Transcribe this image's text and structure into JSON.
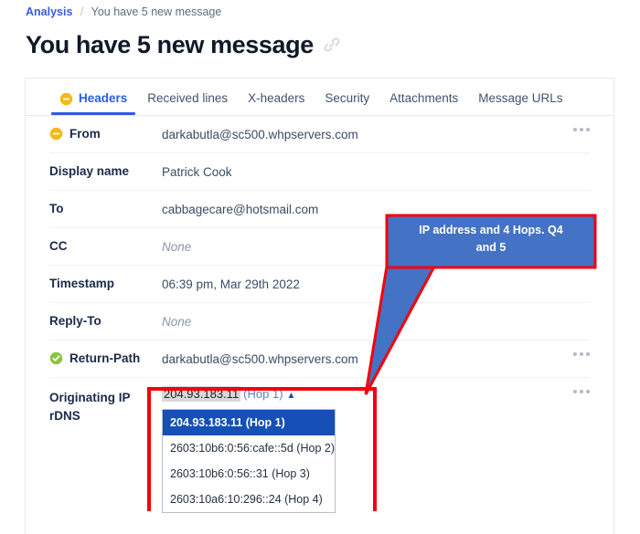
{
  "breadcrumb": {
    "root_label": "Analysis",
    "separator": "/",
    "current_label": "You have 5 new message"
  },
  "header": {
    "title": "You have 5 new message",
    "link_icon": "link-icon"
  },
  "tabs": [
    {
      "label": "Headers",
      "active": true,
      "icon": "minus-circle-warning-icon"
    },
    {
      "label": "Received lines",
      "active": false
    },
    {
      "label": "X-headers",
      "active": false
    },
    {
      "label": "Security",
      "active": false
    },
    {
      "label": "Attachments",
      "active": false
    },
    {
      "label": "Message URLs",
      "active": false
    }
  ],
  "rows": [
    {
      "label": "From",
      "value": "darkabutla@sc500.whpservers.com",
      "icon": "minus-circle-warning-icon",
      "is_none": false,
      "more": true
    },
    {
      "label": "Display name",
      "value": "Patrick Cook",
      "icon": null,
      "is_none": false,
      "more": false
    },
    {
      "label": "To",
      "value": "cabbagecare@hotsmail.com",
      "icon": null,
      "is_none": false,
      "more": false
    },
    {
      "label": "CC",
      "value": "None",
      "icon": null,
      "is_none": true,
      "more": false
    },
    {
      "label": "Timestamp",
      "value": "06:39 pm, Mar 29th 2022",
      "icon": null,
      "is_none": false,
      "more": false
    },
    {
      "label": "Reply-To",
      "value": "None",
      "icon": null,
      "is_none": true,
      "more": false
    },
    {
      "label": "Return-Path",
      "value": "darkabutla@sc500.whpservers.com",
      "icon": "check-circle-success-icon",
      "is_none": false,
      "more": true
    }
  ],
  "originating": {
    "label_line1": "Originating IP",
    "label_line2": "rDNS",
    "selected_ip": "204.93.183.11",
    "selected_hop": "(Hop 1)",
    "caret": "▲",
    "options": [
      {
        "text": "204.93.183.11 (Hop 1)",
        "selected": true
      },
      {
        "text": "2603:10b6:0:56:cafe::5d (Hop 2)",
        "selected": false
      },
      {
        "text": "2603:10b6:0:56::31 (Hop 3)",
        "selected": false
      },
      {
        "text": "2603:10a6:10:296::24 (Hop 4)",
        "selected": false
      }
    ],
    "more": true
  },
  "annotations": {
    "callout_text": "IP address and 4 Hops.  Q4 and 5",
    "callout_line1": "IP address and 4 Hops.  Q4",
    "callout_line2": "and 5",
    "callout_fill": "#4472c4",
    "callout_border": "#f5000a",
    "highlight_rect_color": "#f5000a"
  }
}
